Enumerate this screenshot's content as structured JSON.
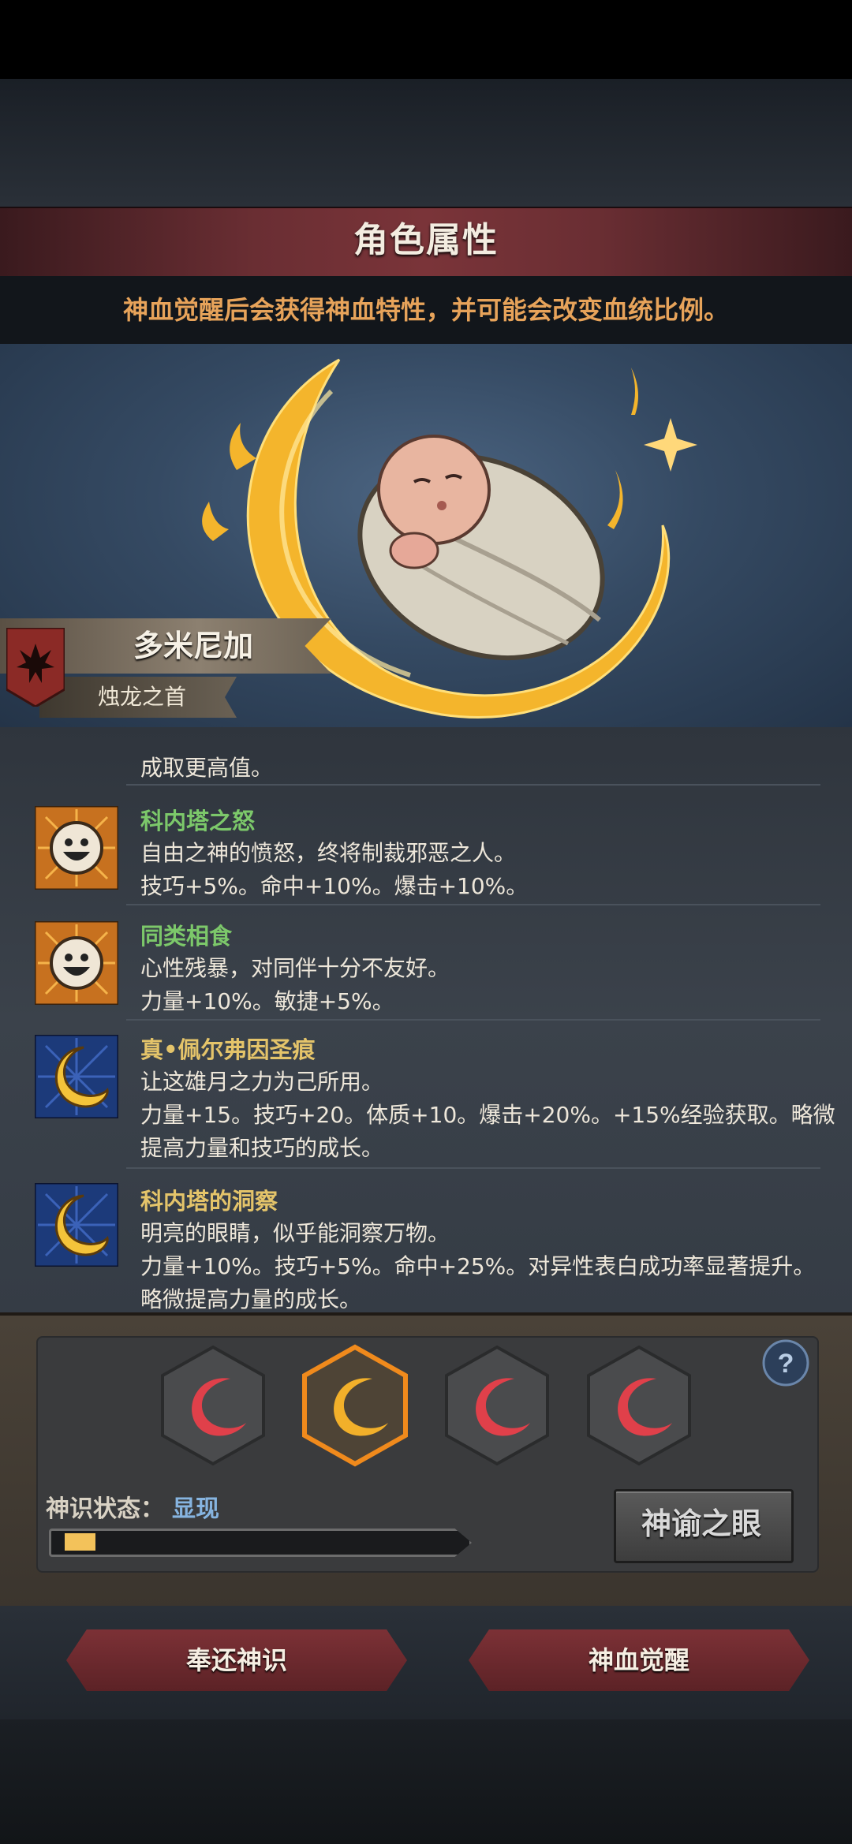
{
  "header": {
    "title": "角色属性",
    "subtitle": "神血觉醒后会获得神血特性，并可能会改变血统比例。"
  },
  "character": {
    "name": "多米尼加",
    "epithet": "烛龙之首"
  },
  "traits": {
    "cut_line": "成取更高值。",
    "items": [
      {
        "name": "科内塔之怒",
        "icon": "sun-face-icon",
        "name_color": "#7cc86a",
        "desc": "自由之神的愤怒，终将制裁邪恶之人。",
        "effect": "技巧+5%。命中+10%。爆击+10%。",
        "effect2": ""
      },
      {
        "name": "同类相食",
        "icon": "sun-face-icon",
        "name_color": "#7cc86a",
        "desc": "心性残暴，对同伴十分不友好。",
        "effect": "力量+10%。敏捷+5%。",
        "effect2": ""
      },
      {
        "name": "真•佩尔弗因圣痕",
        "icon": "crescent-moon-icon",
        "name_color": "#e4c46a",
        "desc": "让这雄月之力为己所用。",
        "effect": "力量+15。技巧+20。体质+10。爆击+20%。+15%经验获取。略微",
        "effect2": "提高力量和技巧的成长。"
      },
      {
        "name": "科内塔的洞察",
        "icon": "crescent-moon-icon",
        "name_color": "#e4c46a",
        "desc": "明亮的眼睛，似乎能洞察万物。",
        "effect": "力量+10%。技巧+5%。命中+25%。对异性表白成功率显著提升。",
        "effect2": "略微提高力量的成长。"
      }
    ]
  },
  "awakening": {
    "slots": [
      {
        "icon": "red-crescent-icon",
        "active": false
      },
      {
        "icon": "gold-crescent-icon",
        "active": true
      },
      {
        "icon": "red-crescent-icon",
        "active": false
      },
      {
        "icon": "red-crescent-icon",
        "active": false
      }
    ],
    "status_label": "神识状态：",
    "status_value": "显现",
    "progress": 0.08,
    "oracle_button": "神谕之眼",
    "help_icon": "question-icon"
  },
  "actions": {
    "return_button": "奉还神识",
    "awaken_button": "神血觉醒"
  },
  "colors": {
    "accent_orange": "#e7a35a",
    "title_red": "#6a2e33",
    "progress_gold": "#f3c25a"
  }
}
